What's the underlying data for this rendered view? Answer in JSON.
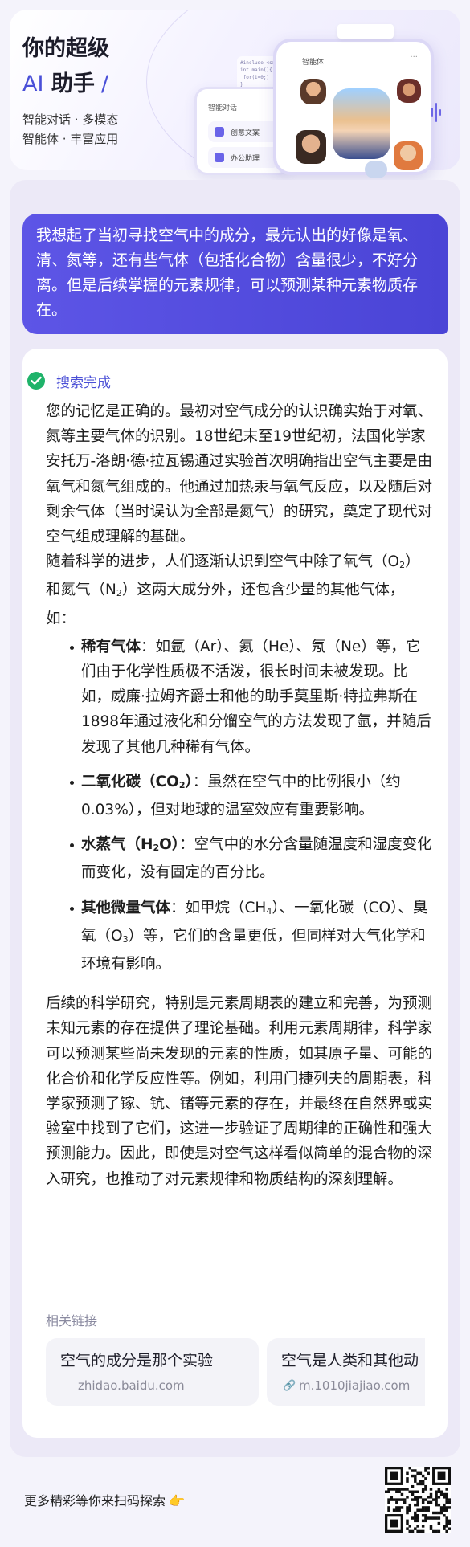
{
  "header": {
    "title": "你的超级",
    "subtitle_ai": "AI",
    "subtitle_rest": "助手",
    "slash": "/",
    "tagline_1": "智能对话 · 多模态",
    "tagline_2": "智能体 · 丰富应用",
    "mock_phone_back_title": "智能对话",
    "mock_row_1": "创意文案",
    "mock_row_2": "办公助理",
    "mock_phone_front_title": "智能体"
  },
  "user_message": "我想起了当初寻找空气中的成分，最先认出的好像是氧、清、氮等，还有些气体（包括化合物）含量很少，不好分离。但是后续掌握的元素规律，可以预测某种元素物质存在。",
  "answer": {
    "status": "搜索完成",
    "intro": "您的记忆是正确的。最初对空气成分的认识确实始于对氧、氮等主要气体的识别。18世纪末至19世纪初，法国化学家安托万-洛朗·德·拉瓦锡通过实验首次明确指出空气主要是由氧气和氮气组成的。他通过加热汞与氧气反应，以及随后对剩余气体（当时误认为全部是氮气）的研究，奠定了现代对空气组成理解的基础。",
    "para2_a": "随着科学的进步，人们逐渐认识到空气中除了氧气（O",
    "para2_sub1": "2",
    "para2_b": "）和氮气（N",
    "para2_sub2": "2",
    "para2_c": "）这两大成分外，还包含少量的其他气体，如：",
    "items": [
      {
        "term": "稀有气体",
        "text": "：如氩（Ar）、氦（He）、氖（Ne）等，它们由于化学性质极不活泼，很长时间未被发现。比如，威廉·拉姆齐爵士和他的助手莫里斯·特拉弗斯在1898年通过液化和分馏空气的方法发现了氩，并随后发现了其他几种稀有气体。"
      },
      {
        "term_a": "二氧化碳（CO",
        "term_sub": "2",
        "term_b": "）",
        "text": "：虽然在空气中的比例很小（约0.03%），但对地球的温室效应有重要影响。"
      },
      {
        "term_a": "水蒸气（H",
        "term_sub": "2",
        "term_b": "O）",
        "text": "：空气中的水分含量随温度和湿度变化而变化，没有固定的百分比。"
      },
      {
        "term": "其他微量气体",
        "text_a": "：如甲烷（CH",
        "text_sub1": "4",
        "text_b": "）、一氧化碳（CO）、臭氧（O",
        "text_sub2": "3",
        "text_c": "）等，它们的含量更低，但同样对大气化学和环境有影响。"
      }
    ],
    "closing": "后续的科学研究，特别是元素周期表的建立和完善，为预测未知元素的存在提供了理论基础。利用元素周期律，科学家可以预测某些尚未发现的元素的性质，如其原子量、可能的化合价和化学反应性等。例如，利用门捷列夫的周期表，科学家预测了镓、钪、锗等元素的存在，并最终在自然界或实验室中找到了它们，这进一步验证了周期律的正确性和强大预测能力。因此，即使是对空气这样看似简单的混合物的深入研究，也推动了对元素规律和物质结构的深刻理解。"
  },
  "related": {
    "title": "相关链接",
    "links": [
      {
        "title": "空气的成分是那个实验",
        "domain": "zhidao.baidu.com"
      },
      {
        "title": "空气是人类和其他动",
        "domain": "m.1010jiajiao.com"
      }
    ]
  },
  "footer": {
    "text": "更多精彩等你来扫码探索",
    "emoji": "👉"
  }
}
